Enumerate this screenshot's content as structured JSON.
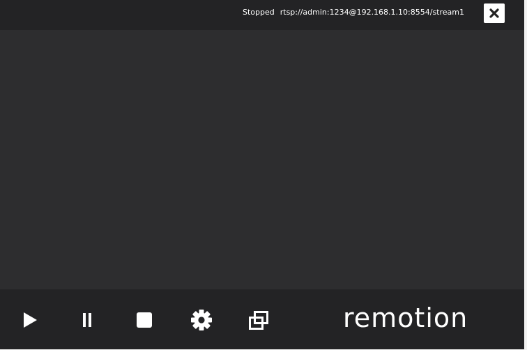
{
  "topbar": {
    "status": "Stopped",
    "stream_url": "rtsp://admin:1234@192.168.1.10:8554/stream1",
    "close_icon": "close-icon"
  },
  "controls": {
    "play_icon": "play-icon",
    "pause_icon": "pause-icon",
    "stop_icon": "stop-icon",
    "settings_icon": "gear-icon",
    "popout_icon": "popout-window-icon"
  },
  "brand": {
    "logo_text": "remotion"
  },
  "colors": {
    "background": "#2d2d2f",
    "bar": "#232325",
    "foreground": "#ffffff"
  }
}
